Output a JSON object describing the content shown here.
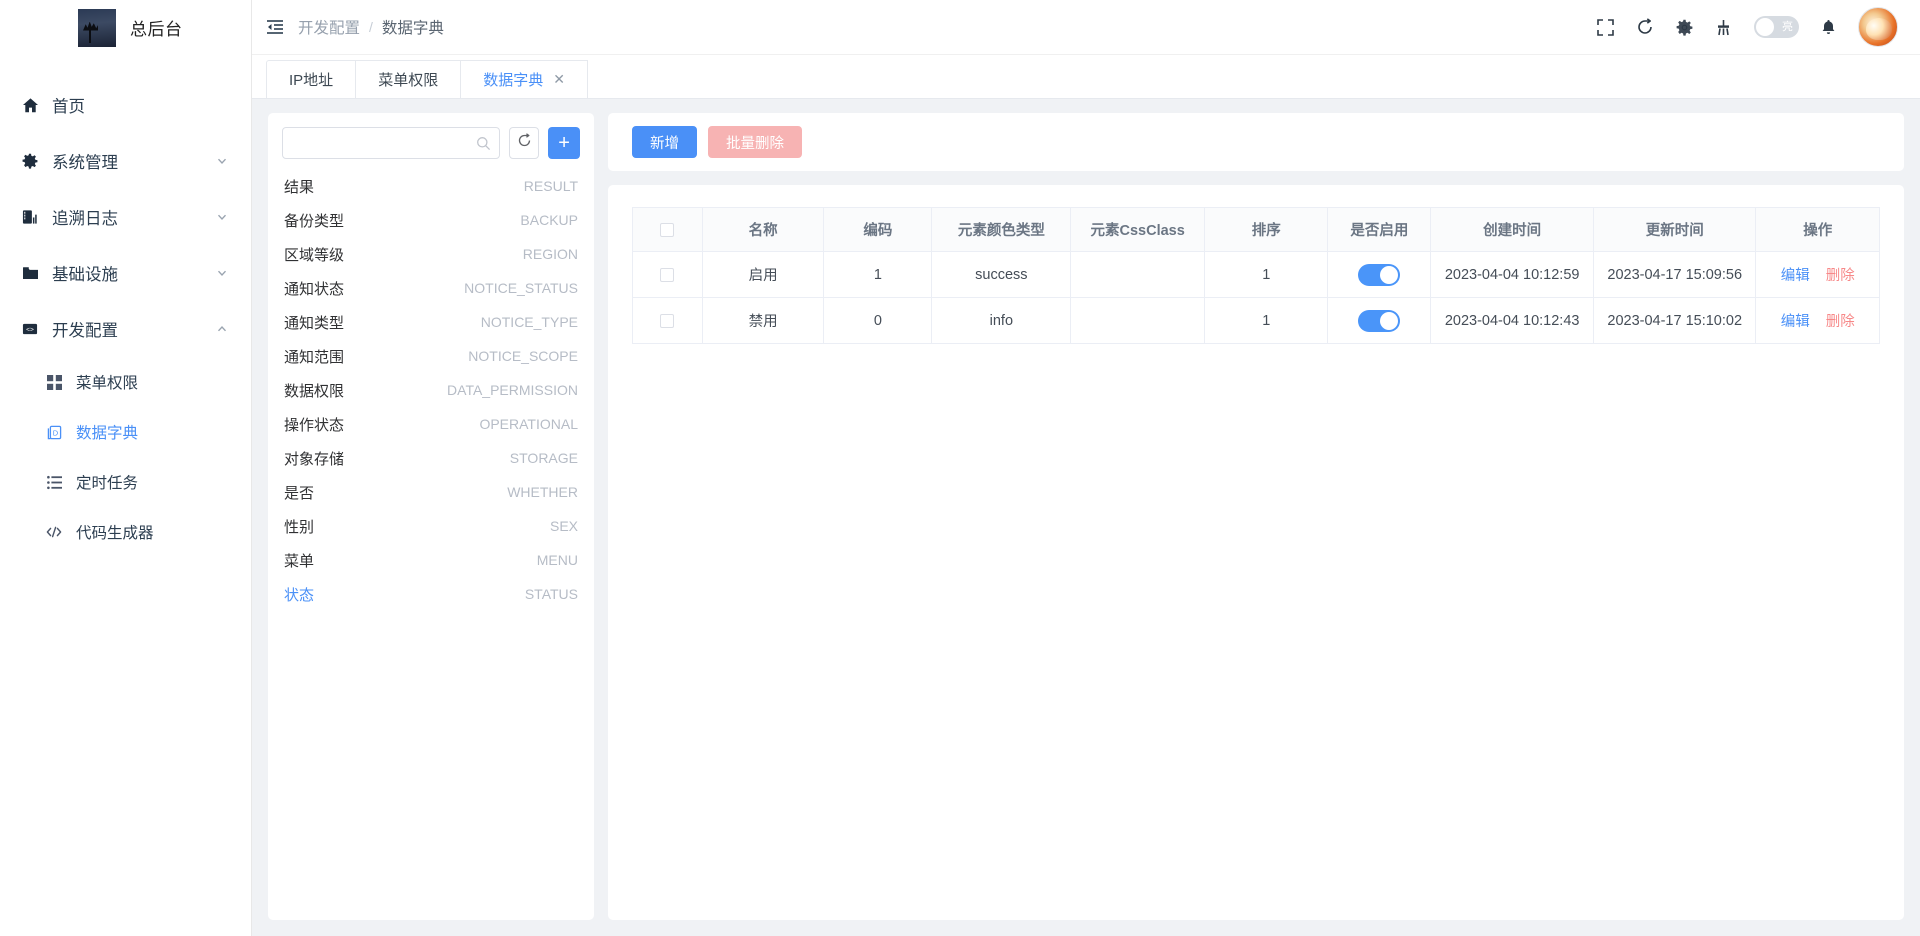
{
  "brand": {
    "title": "总后台",
    "logo_icon": "app-logo-image"
  },
  "header": {
    "collapse_icon": "menu-fold-icon",
    "breadcrumb": [
      "开发配置",
      "数据字典"
    ],
    "breadcrumb_separator": "/",
    "icons": [
      "fullscreen-icon",
      "refresh-icon",
      "gear-icon",
      "broom-icon",
      "bell-icon"
    ],
    "theme_toggle_label": "亮",
    "avatar_icon": "user-avatar"
  },
  "sidebar": {
    "items": [
      {
        "label": "首页",
        "icon": "home-icon",
        "expandable": false,
        "active": false,
        "sub": false
      },
      {
        "label": "系统管理",
        "icon": "gear-icon",
        "expandable": true,
        "chevron": "chevron-down",
        "active": false,
        "sub": false
      },
      {
        "label": "追溯日志",
        "icon": "log-book-icon",
        "expandable": true,
        "chevron": "chevron-down",
        "active": false,
        "sub": false
      },
      {
        "label": "基础设施",
        "icon": "folder-icon",
        "expandable": true,
        "chevron": "chevron-down",
        "active": false,
        "sub": false
      },
      {
        "label": "开发配置",
        "icon": "code-config-icon",
        "expandable": true,
        "chevron": "chevron-up",
        "active": false,
        "sub": false
      },
      {
        "label": "菜单权限",
        "icon": "grid-icon",
        "expandable": false,
        "active": false,
        "sub": true
      },
      {
        "label": "数据字典",
        "icon": "dictionary-icon",
        "expandable": false,
        "active": true,
        "sub": true
      },
      {
        "label": "定时任务",
        "icon": "list-icon",
        "expandable": false,
        "active": false,
        "sub": true
      },
      {
        "label": "代码生成器",
        "icon": "code-slash-icon",
        "expandable": false,
        "active": false,
        "sub": true
      }
    ]
  },
  "tabs": [
    {
      "label": "IP地址",
      "active": false,
      "closable": false
    },
    {
      "label": "菜单权限",
      "active": false,
      "closable": false
    },
    {
      "label": "数据字典",
      "active": true,
      "closable": true,
      "close_icon": "close-icon"
    }
  ],
  "dict_panel": {
    "search": {
      "value": "",
      "placeholder": "",
      "icon": "search-icon"
    },
    "refresh_icon": "refresh-icon",
    "add_icon": "plus-icon",
    "items": [
      {
        "name": "结果",
        "code": "RESULT",
        "active": false
      },
      {
        "name": "备份类型",
        "code": "BACKUP",
        "active": false
      },
      {
        "name": "区域等级",
        "code": "REGION",
        "active": false
      },
      {
        "name": "通知状态",
        "code": "NOTICE_STATUS",
        "active": false
      },
      {
        "name": "通知类型",
        "code": "NOTICE_TYPE",
        "active": false
      },
      {
        "name": "通知范围",
        "code": "NOTICE_SCOPE",
        "active": false
      },
      {
        "name": "数据权限",
        "code": "DATA_PERMISSION",
        "active": false
      },
      {
        "name": "操作状态",
        "code": "OPERATIONAL",
        "active": false
      },
      {
        "name": "对象存储",
        "code": "STORAGE",
        "active": false
      },
      {
        "name": "是否",
        "code": "WHETHER",
        "active": false
      },
      {
        "name": "性别",
        "code": "SEX",
        "active": false
      },
      {
        "name": "菜单",
        "code": "MENU",
        "active": false
      },
      {
        "name": "状态",
        "code": "STATUS",
        "active": true
      }
    ]
  },
  "toolbar": {
    "add_label": "新增",
    "batch_delete_label": "批量删除",
    "add_color": "#4a90f7",
    "batch_delete_color": "#f7b3b3"
  },
  "table": {
    "select_all_checked": false,
    "columns": [
      "",
      "名称",
      "编码",
      "元素颜色类型",
      "元素CssClass",
      "排序",
      "是否启用",
      "创建时间",
      "更新时间",
      "操作"
    ],
    "rows": [
      {
        "checked": false,
        "name": "启用",
        "code": "1",
        "color_type": "success",
        "css_class": "",
        "sort": "1",
        "enabled": true,
        "created_at": "2023-04-04 10:12:59",
        "updated_at": "2023-04-17 15:09:56",
        "edit_label": "编辑",
        "delete_label": "删除"
      },
      {
        "checked": false,
        "name": "禁用",
        "code": "0",
        "color_type": "info",
        "css_class": "",
        "sort": "1",
        "enabled": true,
        "created_at": "2023-04-04 10:12:43",
        "updated_at": "2023-04-17 15:10:02",
        "edit_label": "编辑",
        "delete_label": "删除"
      }
    ]
  }
}
